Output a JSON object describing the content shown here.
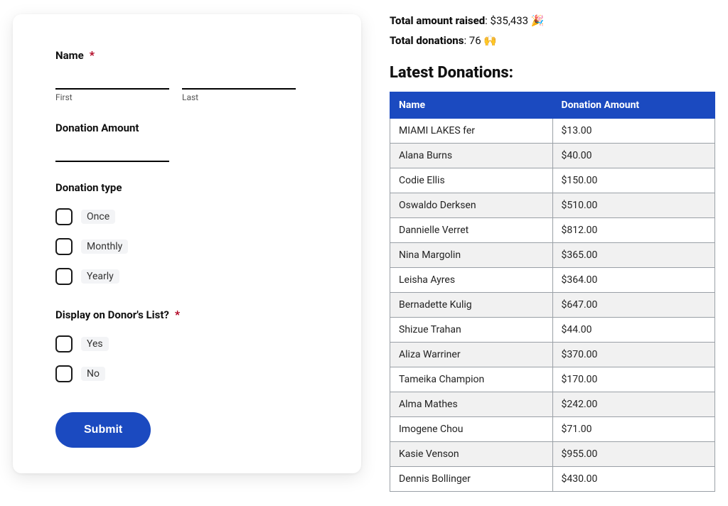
{
  "form": {
    "name_label": "Name",
    "name_required": "*",
    "first_sub": "First",
    "last_sub": "Last",
    "amount_label": "Donation Amount",
    "type_label": "Donation type",
    "type_options": [
      "Once",
      "Monthly",
      "Yearly"
    ],
    "display_label": "Display on Donor's List?",
    "display_required": "*",
    "display_options": [
      "Yes",
      "No"
    ],
    "submit_label": "Submit"
  },
  "stats": {
    "raised_label": "Total amount raised",
    "raised_value": "$35,433",
    "raised_emoji": "🎉",
    "donations_label": "Total donations",
    "donations_value": "76",
    "donations_emoji": "🙌"
  },
  "table": {
    "heading": "Latest Donations:",
    "col_name": "Name",
    "col_amount": "Donation Amount",
    "rows": [
      {
        "name": "MIAMI LAKES fer",
        "amount": "$13.00"
      },
      {
        "name": "Alana Burns",
        "amount": "$40.00"
      },
      {
        "name": "Codie Ellis",
        "amount": "$150.00"
      },
      {
        "name": "Oswaldo Derksen",
        "amount": "$510.00"
      },
      {
        "name": "Dannielle Verret",
        "amount": "$812.00"
      },
      {
        "name": "Nina Margolin",
        "amount": "$365.00"
      },
      {
        "name": "Leisha Ayres",
        "amount": "$364.00"
      },
      {
        "name": "Bernadette Kulig",
        "amount": "$647.00"
      },
      {
        "name": "Shizue Trahan",
        "amount": "$44.00"
      },
      {
        "name": "Aliza Warriner",
        "amount": "$370.00"
      },
      {
        "name": "Tameika Champion",
        "amount": "$170.00"
      },
      {
        "name": "Alma Mathes",
        "amount": "$242.00"
      },
      {
        "name": "Imogene Chou",
        "amount": "$71.00"
      },
      {
        "name": "Kasie Venson",
        "amount": "$955.00"
      },
      {
        "name": "Dennis Bollinger",
        "amount": "$430.00"
      }
    ]
  }
}
